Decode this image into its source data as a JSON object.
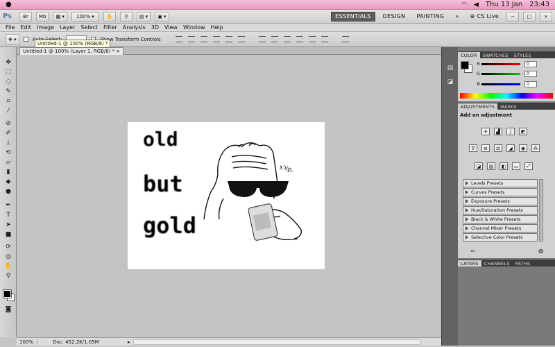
{
  "system_bar": {
    "clock": "Thu 13 Jan",
    "time": "23:43"
  },
  "app_bar": {
    "logo": "Ps",
    "zoom": "100%",
    "workspaces": [
      "ESSENTIALS",
      "DESIGN",
      "PAINTING"
    ],
    "more": "»",
    "cs_live": "CS Live"
  },
  "menu": [
    "File",
    "Edit",
    "Image",
    "Layer",
    "Select",
    "Filter",
    "Analysis",
    "3D",
    "View",
    "Window",
    "Help"
  ],
  "options_bar": {
    "auto_select": "Auto-Select:",
    "show_transform": "Show Transform Controls"
  },
  "tooltip": "Untitled-1 @ 100% (RGB/8) *",
  "document": {
    "tab_title": "Untitled-1 @ 100% (Layer 1, RGB/8) *",
    "close": "×"
  },
  "artwork_text": {
    "line1": "old",
    "line2": "but",
    "line3": "gold",
    "sip": "s'iip."
  },
  "status_bar": {
    "zoom": "100%",
    "doc": "Doc: 452.2K/1.05M"
  },
  "color_panel": {
    "tabs": [
      "COLOR",
      "SWATCHES",
      "STYLES"
    ],
    "r_label": "R",
    "g_label": "G",
    "b_label": "B",
    "r": "0",
    "g": "0",
    "b": "0"
  },
  "adjustments_panel": {
    "tabs": [
      "ADJUSTMENTS",
      "MASKS"
    ],
    "heading": "Add an adjustment",
    "presets": [
      "Levels Presets",
      "Curves Presets",
      "Exposure Presets",
      "Hue/Saturation Presets",
      "Black & White Presets",
      "Channel Mixer Presets",
      "Selective Color Presets"
    ]
  },
  "layers_panel": {
    "tabs": [
      "LAYERS",
      "CHANNELS",
      "PATHS"
    ]
  },
  "colors": {
    "sys_bar": "#e9a3c6",
    "workspace_active": "#5d5d5d",
    "panel_dark": "#3d3d3d"
  }
}
